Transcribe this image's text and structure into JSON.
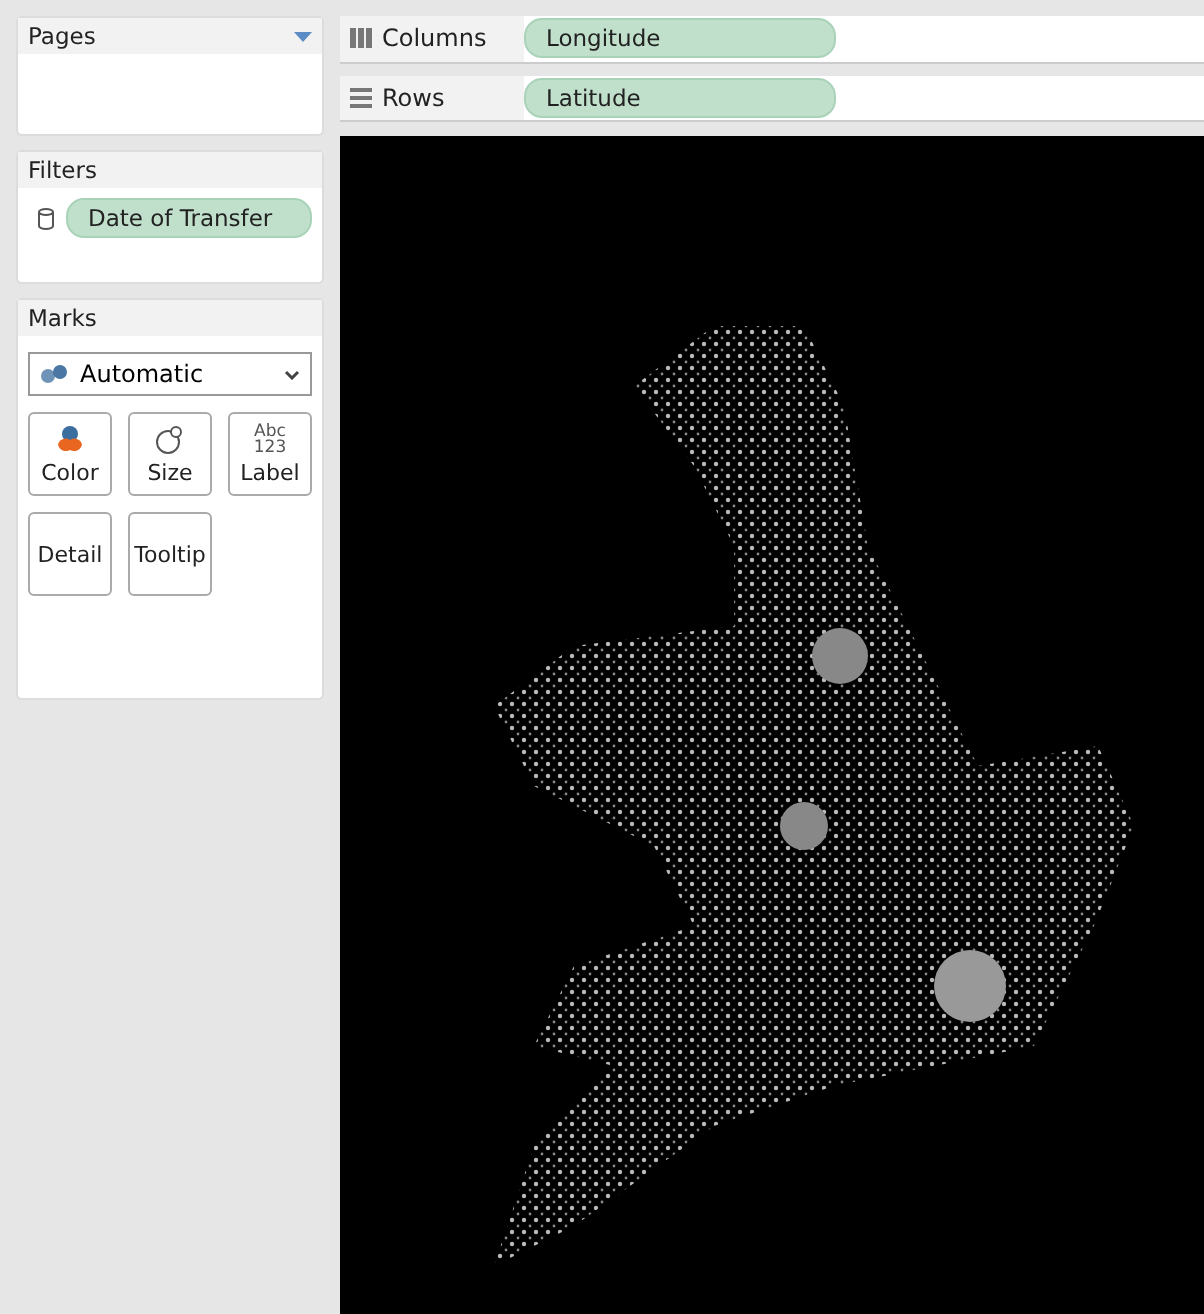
{
  "pages": {
    "title": "Pages"
  },
  "filters": {
    "title": "Filters",
    "pills": [
      {
        "label": "Date of Transfer"
      }
    ]
  },
  "marks": {
    "title": "Marks",
    "mark_type": "Automatic",
    "cards": [
      {
        "kind": "color",
        "label": "Color"
      },
      {
        "kind": "size",
        "label": "Size"
      },
      {
        "kind": "text",
        "label": "Label",
        "icon_lines": [
          "Abc",
          "123"
        ]
      },
      {
        "kind": "detail",
        "label": "Detail"
      },
      {
        "kind": "tooltip",
        "label": "Tooltip"
      }
    ]
  },
  "shelves": [
    {
      "kind": "columns",
      "title": "Columns",
      "pill": "Longitude"
    },
    {
      "kind": "rows",
      "title": "Rows",
      "pill": "Latitude"
    }
  ]
}
